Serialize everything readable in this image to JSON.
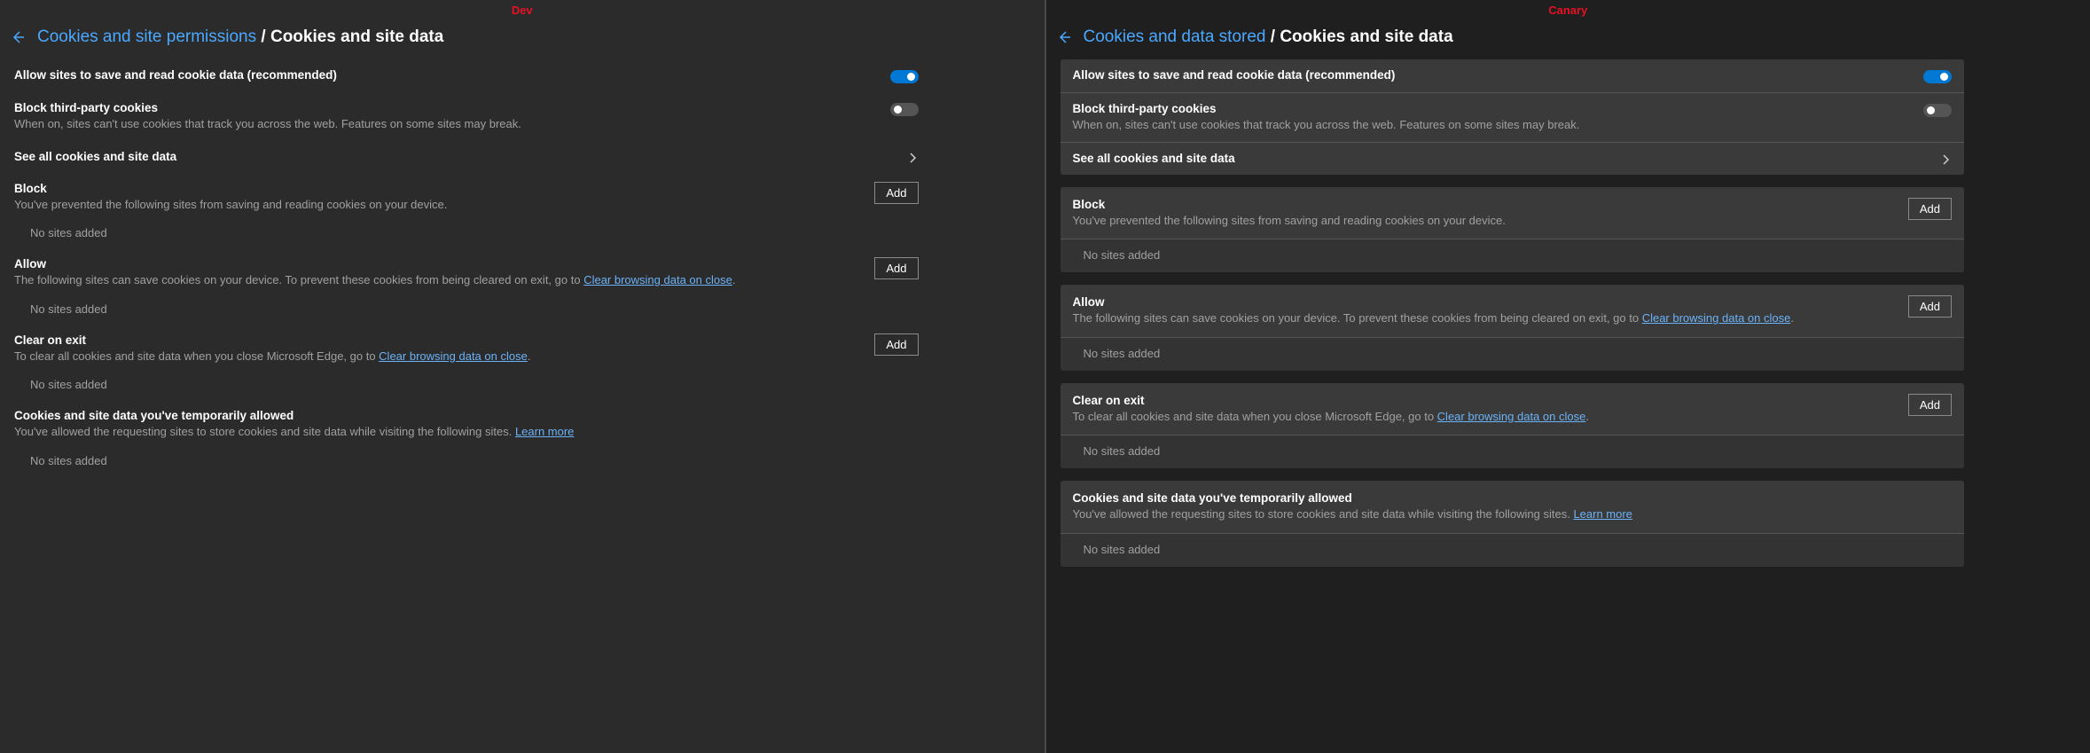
{
  "left": {
    "variant_label": "Dev",
    "breadcrumb_link": "Cookies and site permissions",
    "breadcrumb_page": "Cookies and site data",
    "allow_sites": {
      "title": "Allow sites to save and read cookie data (recommended)",
      "on": true
    },
    "block_third": {
      "title": "Block third-party cookies",
      "desc": "When on, sites can't use cookies that track you across the web. Features on some sites may break.",
      "on": false
    },
    "see_all": {
      "title": "See all cookies and site data"
    },
    "block": {
      "title": "Block",
      "desc": "You've prevented the following sites from saving and reading cookies on your device.",
      "add": "Add",
      "empty": "No sites added"
    },
    "allow": {
      "title": "Allow",
      "desc1": "The following sites can save cookies on your device. To prevent these cookies from being cleared on exit, go to ",
      "link": "Clear browsing data on close",
      "desc2": ".",
      "add": "Add",
      "empty": "No sites added"
    },
    "clear_exit": {
      "title": "Clear on exit",
      "desc1": "To clear all cookies and site data when you close Microsoft Edge, go to ",
      "link": "Clear browsing data on close",
      "desc2": ".",
      "add": "Add",
      "empty": "No sites added"
    },
    "temp": {
      "title": "Cookies and site data you've temporarily allowed",
      "desc1": "You've allowed the requesting sites to store cookies and site data while visiting the following sites. ",
      "link": "Learn more",
      "empty": "No sites added"
    }
  },
  "right": {
    "variant_label": "Canary",
    "breadcrumb_link": "Cookies and data stored",
    "breadcrumb_page": "Cookies and site data",
    "allow_sites": {
      "title": "Allow sites to save and read cookie data (recommended)",
      "on": true
    },
    "block_third": {
      "title": "Block third-party cookies",
      "desc": "When on, sites can't use cookies that track you across the web. Features on some sites may break.",
      "on": false
    },
    "see_all": {
      "title": "See all cookies and site data"
    },
    "block": {
      "title": "Block",
      "desc": "You've prevented the following sites from saving and reading cookies on your device.",
      "add": "Add",
      "empty": "No sites added"
    },
    "allow": {
      "title": "Allow",
      "desc1": "The following sites can save cookies on your device. To prevent these cookies from being cleared on exit, go to ",
      "link": "Clear browsing data on close",
      "desc2": ".",
      "add": "Add",
      "empty": "No sites added"
    },
    "clear_exit": {
      "title": "Clear on exit",
      "desc1": "To clear all cookies and site data when you close Microsoft Edge, go to ",
      "link": "Clear browsing data on close",
      "desc2": ".",
      "add": "Add",
      "empty": "No sites added"
    },
    "temp": {
      "title": "Cookies and site data you've temporarily allowed",
      "desc1": "You've allowed the requesting sites to store cookies and site data while visiting the following sites. ",
      "link": "Learn more",
      "empty": "No sites added"
    }
  }
}
